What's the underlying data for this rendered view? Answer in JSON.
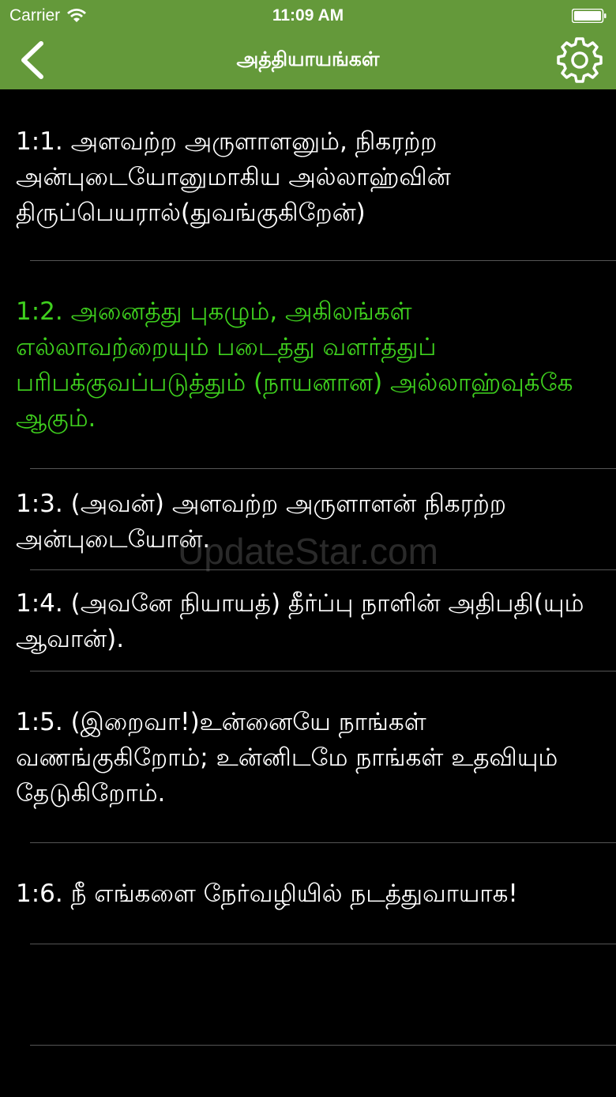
{
  "status_bar": {
    "carrier": "Carrier",
    "time": "11:09 AM"
  },
  "nav": {
    "title": "அத்தியாயங்கள்",
    "back_icon": "chevron-left-icon",
    "settings_icon": "gear-icon"
  },
  "colors": {
    "header_bg": "#64993a",
    "highlight": "#3fd11e",
    "background": "#000000"
  },
  "verses": [
    {
      "text": "1:1. அளவற்ற அருளாளனும், நிகரற்ற அன்புடையோனுமாகிய அல்லாஹ்வின் திருப்பெயரால்(துவங்குகிறேன்)",
      "highlighted": false
    },
    {
      "text": "1:2. அனைத்து புகழும், அகிலங்கள் எல்லாவற்றையும் படைத்து வளர்த்துப் பரிபக்குவப்படுத்தும் (நாயனான) அல்லாஹ்வுக்கே ஆகும்.",
      "highlighted": true
    },
    {
      "text": "1:3. (அவன்) அளவற்ற அருளாளன் நிகரற்ற அன்புடையோன்.",
      "highlighted": false
    },
    {
      "text": "1:4. (அவனே நியாயத்) தீர்ப்பு நாளின் அதிபதி(யும் ஆவான்).",
      "highlighted": false
    },
    {
      "text": "1:5. (இறைவா!)உன்னையே நாங்கள் வணங்குகிறோம்; உன்னிடமே நாங்கள் உதவியும் தேடுகிறோம்.",
      "highlighted": false
    },
    {
      "text": "1:6. நீ எங்களை நேர்வழியில் நடத்துவாயாக!",
      "highlighted": false
    },
    {
      "text": "",
      "highlighted": false
    }
  ],
  "watermark": "UpdateStar.com"
}
